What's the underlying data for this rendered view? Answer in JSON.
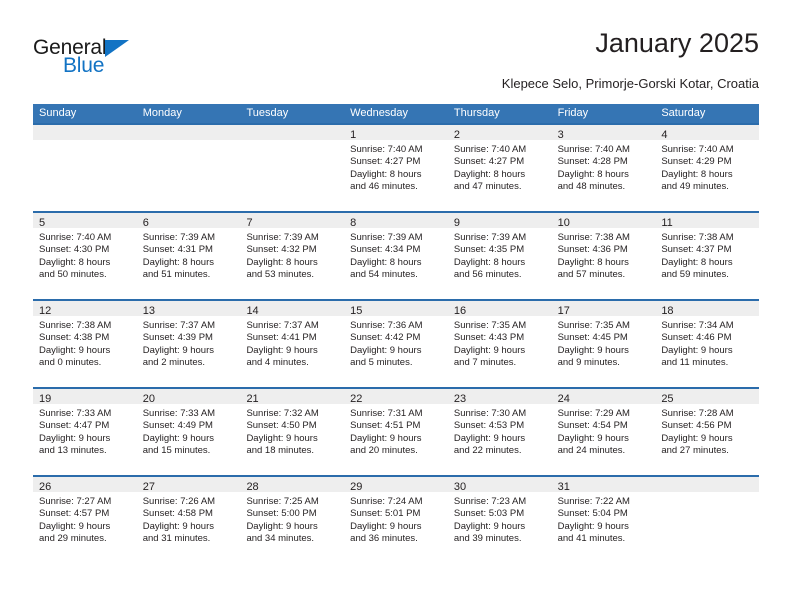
{
  "brand": {
    "name_part1": "General",
    "name_part2": "Blue"
  },
  "header": {
    "title": "January 2025",
    "subtitle": "Klepece Selo, Primorje-Gorski Kotar, Croatia"
  },
  "colors": {
    "header_blue": "#3575b4",
    "row_divider_blue": "#2b6cab",
    "daynum_band": "#eeeeee",
    "logo_blue": "#1273c4",
    "text": "#231f20"
  },
  "weekdays": [
    "Sunday",
    "Monday",
    "Tuesday",
    "Wednesday",
    "Thursday",
    "Friday",
    "Saturday"
  ],
  "weeks": [
    [
      {
        "day": "",
        "empty": true,
        "sunrise": "",
        "sunset": "",
        "daylight_1": "",
        "daylight_2": ""
      },
      {
        "day": "",
        "empty": true,
        "sunrise": "",
        "sunset": "",
        "daylight_1": "",
        "daylight_2": ""
      },
      {
        "day": "",
        "empty": true,
        "sunrise": "",
        "sunset": "",
        "daylight_1": "",
        "daylight_2": ""
      },
      {
        "day": "1",
        "empty": false,
        "sunrise": "Sunrise: 7:40 AM",
        "sunset": "Sunset: 4:27 PM",
        "daylight_1": "Daylight: 8 hours",
        "daylight_2": "and 46 minutes."
      },
      {
        "day": "2",
        "empty": false,
        "sunrise": "Sunrise: 7:40 AM",
        "sunset": "Sunset: 4:27 PM",
        "daylight_1": "Daylight: 8 hours",
        "daylight_2": "and 47 minutes."
      },
      {
        "day": "3",
        "empty": false,
        "sunrise": "Sunrise: 7:40 AM",
        "sunset": "Sunset: 4:28 PM",
        "daylight_1": "Daylight: 8 hours",
        "daylight_2": "and 48 minutes."
      },
      {
        "day": "4",
        "empty": false,
        "sunrise": "Sunrise: 7:40 AM",
        "sunset": "Sunset: 4:29 PM",
        "daylight_1": "Daylight: 8 hours",
        "daylight_2": "and 49 minutes."
      }
    ],
    [
      {
        "day": "5",
        "empty": false,
        "sunrise": "Sunrise: 7:40 AM",
        "sunset": "Sunset: 4:30 PM",
        "daylight_1": "Daylight: 8 hours",
        "daylight_2": "and 50 minutes."
      },
      {
        "day": "6",
        "empty": false,
        "sunrise": "Sunrise: 7:39 AM",
        "sunset": "Sunset: 4:31 PM",
        "daylight_1": "Daylight: 8 hours",
        "daylight_2": "and 51 minutes."
      },
      {
        "day": "7",
        "empty": false,
        "sunrise": "Sunrise: 7:39 AM",
        "sunset": "Sunset: 4:32 PM",
        "daylight_1": "Daylight: 8 hours",
        "daylight_2": "and 53 minutes."
      },
      {
        "day": "8",
        "empty": false,
        "sunrise": "Sunrise: 7:39 AM",
        "sunset": "Sunset: 4:34 PM",
        "daylight_1": "Daylight: 8 hours",
        "daylight_2": "and 54 minutes."
      },
      {
        "day": "9",
        "empty": false,
        "sunrise": "Sunrise: 7:39 AM",
        "sunset": "Sunset: 4:35 PM",
        "daylight_1": "Daylight: 8 hours",
        "daylight_2": "and 56 minutes."
      },
      {
        "day": "10",
        "empty": false,
        "sunrise": "Sunrise: 7:38 AM",
        "sunset": "Sunset: 4:36 PM",
        "daylight_1": "Daylight: 8 hours",
        "daylight_2": "and 57 minutes."
      },
      {
        "day": "11",
        "empty": false,
        "sunrise": "Sunrise: 7:38 AM",
        "sunset": "Sunset: 4:37 PM",
        "daylight_1": "Daylight: 8 hours",
        "daylight_2": "and 59 minutes."
      }
    ],
    [
      {
        "day": "12",
        "empty": false,
        "sunrise": "Sunrise: 7:38 AM",
        "sunset": "Sunset: 4:38 PM",
        "daylight_1": "Daylight: 9 hours",
        "daylight_2": "and 0 minutes."
      },
      {
        "day": "13",
        "empty": false,
        "sunrise": "Sunrise: 7:37 AM",
        "sunset": "Sunset: 4:39 PM",
        "daylight_1": "Daylight: 9 hours",
        "daylight_2": "and 2 minutes."
      },
      {
        "day": "14",
        "empty": false,
        "sunrise": "Sunrise: 7:37 AM",
        "sunset": "Sunset: 4:41 PM",
        "daylight_1": "Daylight: 9 hours",
        "daylight_2": "and 4 minutes."
      },
      {
        "day": "15",
        "empty": false,
        "sunrise": "Sunrise: 7:36 AM",
        "sunset": "Sunset: 4:42 PM",
        "daylight_1": "Daylight: 9 hours",
        "daylight_2": "and 5 minutes."
      },
      {
        "day": "16",
        "empty": false,
        "sunrise": "Sunrise: 7:35 AM",
        "sunset": "Sunset: 4:43 PM",
        "daylight_1": "Daylight: 9 hours",
        "daylight_2": "and 7 minutes."
      },
      {
        "day": "17",
        "empty": false,
        "sunrise": "Sunrise: 7:35 AM",
        "sunset": "Sunset: 4:45 PM",
        "daylight_1": "Daylight: 9 hours",
        "daylight_2": "and 9 minutes."
      },
      {
        "day": "18",
        "empty": false,
        "sunrise": "Sunrise: 7:34 AM",
        "sunset": "Sunset: 4:46 PM",
        "daylight_1": "Daylight: 9 hours",
        "daylight_2": "and 11 minutes."
      }
    ],
    [
      {
        "day": "19",
        "empty": false,
        "sunrise": "Sunrise: 7:33 AM",
        "sunset": "Sunset: 4:47 PM",
        "daylight_1": "Daylight: 9 hours",
        "daylight_2": "and 13 minutes."
      },
      {
        "day": "20",
        "empty": false,
        "sunrise": "Sunrise: 7:33 AM",
        "sunset": "Sunset: 4:49 PM",
        "daylight_1": "Daylight: 9 hours",
        "daylight_2": "and 15 minutes."
      },
      {
        "day": "21",
        "empty": false,
        "sunrise": "Sunrise: 7:32 AM",
        "sunset": "Sunset: 4:50 PM",
        "daylight_1": "Daylight: 9 hours",
        "daylight_2": "and 18 minutes."
      },
      {
        "day": "22",
        "empty": false,
        "sunrise": "Sunrise: 7:31 AM",
        "sunset": "Sunset: 4:51 PM",
        "daylight_1": "Daylight: 9 hours",
        "daylight_2": "and 20 minutes."
      },
      {
        "day": "23",
        "empty": false,
        "sunrise": "Sunrise: 7:30 AM",
        "sunset": "Sunset: 4:53 PM",
        "daylight_1": "Daylight: 9 hours",
        "daylight_2": "and 22 minutes."
      },
      {
        "day": "24",
        "empty": false,
        "sunrise": "Sunrise: 7:29 AM",
        "sunset": "Sunset: 4:54 PM",
        "daylight_1": "Daylight: 9 hours",
        "daylight_2": "and 24 minutes."
      },
      {
        "day": "25",
        "empty": false,
        "sunrise": "Sunrise: 7:28 AM",
        "sunset": "Sunset: 4:56 PM",
        "daylight_1": "Daylight: 9 hours",
        "daylight_2": "and 27 minutes."
      }
    ],
    [
      {
        "day": "26",
        "empty": false,
        "sunrise": "Sunrise: 7:27 AM",
        "sunset": "Sunset: 4:57 PM",
        "daylight_1": "Daylight: 9 hours",
        "daylight_2": "and 29 minutes."
      },
      {
        "day": "27",
        "empty": false,
        "sunrise": "Sunrise: 7:26 AM",
        "sunset": "Sunset: 4:58 PM",
        "daylight_1": "Daylight: 9 hours",
        "daylight_2": "and 31 minutes."
      },
      {
        "day": "28",
        "empty": false,
        "sunrise": "Sunrise: 7:25 AM",
        "sunset": "Sunset: 5:00 PM",
        "daylight_1": "Daylight: 9 hours",
        "daylight_2": "and 34 minutes."
      },
      {
        "day": "29",
        "empty": false,
        "sunrise": "Sunrise: 7:24 AM",
        "sunset": "Sunset: 5:01 PM",
        "daylight_1": "Daylight: 9 hours",
        "daylight_2": "and 36 minutes."
      },
      {
        "day": "30",
        "empty": false,
        "sunrise": "Sunrise: 7:23 AM",
        "sunset": "Sunset: 5:03 PM",
        "daylight_1": "Daylight: 9 hours",
        "daylight_2": "and 39 minutes."
      },
      {
        "day": "31",
        "empty": false,
        "sunrise": "Sunrise: 7:22 AM",
        "sunset": "Sunset: 5:04 PM",
        "daylight_1": "Daylight: 9 hours",
        "daylight_2": "and 41 minutes."
      },
      {
        "day": "",
        "empty": true,
        "sunrise": "",
        "sunset": "",
        "daylight_1": "",
        "daylight_2": ""
      }
    ]
  ]
}
